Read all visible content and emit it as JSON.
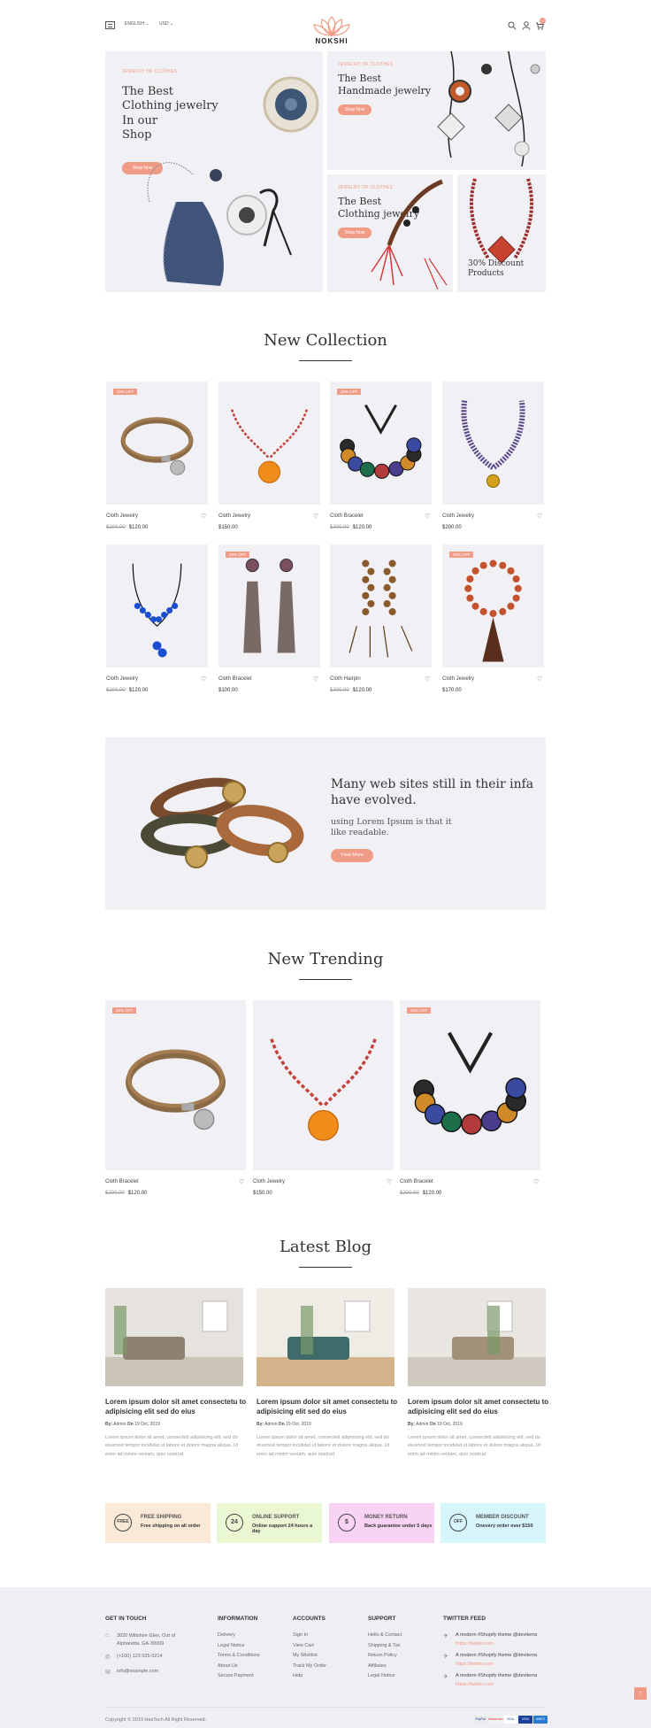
{
  "header": {
    "language": "ENGLISH",
    "currency": "USD",
    "logo": "NOKSHI",
    "cart_count": "0"
  },
  "hero": {
    "main": {
      "tag": "Jewelry of clothes",
      "title": "The Best\nClothing jewelry\nIn our\nShop",
      "button": "Shop Now"
    },
    "top_right": {
      "tag": "Jewelry of clothes",
      "title": "The Best\nHandmade jewelry",
      "button": "Shop Now"
    },
    "bottom_left": {
      "tag": "Jewelry of clothes",
      "title": "The Best\nClothing jewelry",
      "button": "Shop Now"
    },
    "bottom_right": {
      "title": "30% Discount\nProducts"
    }
  },
  "new_collection": {
    "title": "New Collection",
    "products": [
      {
        "badge": "20% OFF",
        "name": "Cloth Jewelry",
        "old_price": "$200.00",
        "price": "$120.00",
        "icon": "leather-bracelet"
      },
      {
        "badge": "",
        "name": "Cloth Jewelry",
        "old_price": "",
        "price": "$150.00",
        "icon": "orange-pendant-necklace"
      },
      {
        "badge": "20% OFF",
        "name": "Cloth Bracelet",
        "old_price": "$200.00",
        "price": "$120.00",
        "icon": "bead-bracelet"
      },
      {
        "badge": "",
        "name": "Cloth Jewelry",
        "old_price": "",
        "price": "$200.00",
        "icon": "beaded-necklace"
      },
      {
        "badge": "",
        "name": "Cloth Jewelry",
        "old_price": "$200.00",
        "price": "$120.00",
        "icon": "blue-bead-necklace"
      },
      {
        "badge": "20% OFF",
        "name": "Cloth Bracelet",
        "old_price": "",
        "price": "$100.00",
        "icon": "tassel-earrings"
      },
      {
        "badge": "",
        "name": "Cloth Hairpin",
        "old_price": "$200.00",
        "price": "$120.00",
        "icon": "wood-bead-strands"
      },
      {
        "badge": "20% OFF",
        "name": "Cloth Jewelry",
        "old_price": "",
        "price": "$170.00",
        "icon": "mala-tassel"
      }
    ]
  },
  "promo": {
    "heading": "Many web sites still in their infa\nhave evolved.",
    "sub": "using Lorem Ipsum is that it\nlike readable.",
    "button": "View More"
  },
  "new_trending": {
    "title": "New Trending",
    "products": [
      {
        "badge": "20% OFF",
        "name": "Cloth Bracelet",
        "old_price": "$200.00",
        "price": "$120.00",
        "icon": "leather-bracelet"
      },
      {
        "badge": "",
        "name": "Cloth Jewelry",
        "old_price": "",
        "price": "$150.00",
        "icon": "orange-pendant-necklace"
      },
      {
        "badge": "20% OFF",
        "name": "Cloth Bracelet",
        "old_price": "$200.00",
        "price": "$120.00",
        "icon": "bead-bracelet"
      }
    ]
  },
  "blog": {
    "title": "Latest Blog",
    "posts": [
      {
        "title": "Lorem ipsum dolor sit amet consectetu to adipisicing elit sed do eius",
        "by_label": "By:",
        "author": "Admin",
        "on_label": "On",
        "date": "19 Oct, 2019",
        "excerpt": "Lorem ipsum dolor sit amet, consectett adipisicing elit, sed do eiusmod tempor incididut ut labore et dolore magna aliqua. Ut enim ad minim veniam, quis nostrud"
      },
      {
        "title": "Lorem ipsum dolor sit amet consectetu to adipisicing elit sed do eius",
        "by_label": "By:",
        "author": "Admin",
        "on_label": "On",
        "date": "19 Oct, 2019",
        "excerpt": "Lorem ipsum dolor sit amet, consectett adipisicing elit, sed do eiusmod tempor incididut ut labore et dolore magna aliqua. Ut enim ad minim veniam, quis nostrud"
      },
      {
        "title": "Lorem ipsum dolor sit amet consectetu to adipisicing elit sed do eius",
        "by_label": "By:",
        "author": "Admin",
        "on_label": "On",
        "date": "19 Oct, 2019",
        "excerpt": "Lorem ipsum dolor sit amet, consectett adipisicing elit, sed do eiusmod tempor incididut ut labore et dolore magna aliqua. Ut enim ad minim veniam, quis nostrud"
      }
    ]
  },
  "features": [
    {
      "title": "Free Shipping",
      "sub": "Free shipping on all order",
      "color": "#fbe9d7",
      "icon": "FREE"
    },
    {
      "title": "Online Support",
      "sub": "Online support 24 hours a day",
      "color": "#eaf7d3",
      "icon": "24"
    },
    {
      "title": "Money Return",
      "sub": "Back guarantee under 5 days",
      "color": "#f8d3f3",
      "icon": "$"
    },
    {
      "title": "Member Discount",
      "sub": "Onevery order over $150",
      "color": "#d7f6fb",
      "icon": "OFF"
    }
  ],
  "footer": {
    "contact": {
      "heading": "Get in touch",
      "address": "3020 Wiltshire Glen, Out of\nAlpharetta, GA-30009",
      "phone": "(+100) 123 025-0214",
      "email": "info@example.com"
    },
    "information": {
      "heading": "Information",
      "links": [
        "Delivery",
        "Legal Notice",
        "Terms & Conditions",
        "About Us",
        "Secure Payment"
      ]
    },
    "accounts": {
      "heading": "Accounts",
      "links": [
        "Sign In",
        "View Cart",
        "My Wishlist",
        "Track My Order",
        "Help"
      ]
    },
    "support": {
      "heading": "Support",
      "links": [
        "Hello & Contact",
        "Shipping & Tax",
        "Return Policy",
        "Affiliates",
        "Legal Notice"
      ]
    },
    "twitter": {
      "heading": "Twitter feed",
      "tweets": [
        {
          "text": "A modern #Shopify theme @devitems",
          "link": "https://twitter.com"
        },
        {
          "text": "A modern #Shopify theme @devitems",
          "link": "https://twitter.com"
        },
        {
          "text": "A modern #Shopify theme @devitems",
          "link": "https://twitter.com"
        }
      ]
    },
    "copyright": "Copyright © 2019 HasTech All Right Reserved.",
    "payments": [
      "PayPal",
      "Mastercard",
      "VISA",
      "VISA",
      "AMEX"
    ]
  },
  "colors": {
    "accent": "#f09b86",
    "panel": "#f1f0f4"
  }
}
